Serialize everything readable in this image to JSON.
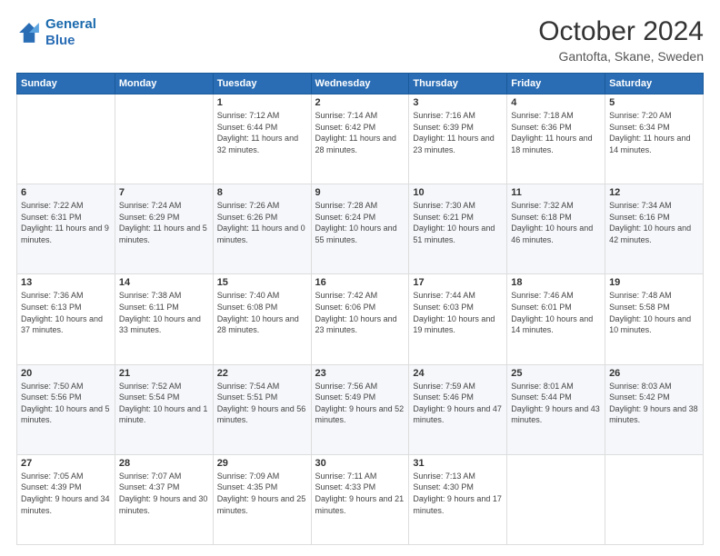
{
  "logo": {
    "line1": "General",
    "line2": "Blue"
  },
  "title": "October 2024",
  "subtitle": "Gantofta, Skane, Sweden",
  "headers": [
    "Sunday",
    "Monday",
    "Tuesday",
    "Wednesday",
    "Thursday",
    "Friday",
    "Saturday"
  ],
  "weeks": [
    [
      {
        "day": "",
        "detail": ""
      },
      {
        "day": "",
        "detail": ""
      },
      {
        "day": "1",
        "detail": "Sunrise: 7:12 AM\nSunset: 6:44 PM\nDaylight: 11 hours and 32 minutes."
      },
      {
        "day": "2",
        "detail": "Sunrise: 7:14 AM\nSunset: 6:42 PM\nDaylight: 11 hours and 28 minutes."
      },
      {
        "day": "3",
        "detail": "Sunrise: 7:16 AM\nSunset: 6:39 PM\nDaylight: 11 hours and 23 minutes."
      },
      {
        "day": "4",
        "detail": "Sunrise: 7:18 AM\nSunset: 6:36 PM\nDaylight: 11 hours and 18 minutes."
      },
      {
        "day": "5",
        "detail": "Sunrise: 7:20 AM\nSunset: 6:34 PM\nDaylight: 11 hours and 14 minutes."
      }
    ],
    [
      {
        "day": "6",
        "detail": "Sunrise: 7:22 AM\nSunset: 6:31 PM\nDaylight: 11 hours and 9 minutes."
      },
      {
        "day": "7",
        "detail": "Sunrise: 7:24 AM\nSunset: 6:29 PM\nDaylight: 11 hours and 5 minutes."
      },
      {
        "day": "8",
        "detail": "Sunrise: 7:26 AM\nSunset: 6:26 PM\nDaylight: 11 hours and 0 minutes."
      },
      {
        "day": "9",
        "detail": "Sunrise: 7:28 AM\nSunset: 6:24 PM\nDaylight: 10 hours and 55 minutes."
      },
      {
        "day": "10",
        "detail": "Sunrise: 7:30 AM\nSunset: 6:21 PM\nDaylight: 10 hours and 51 minutes."
      },
      {
        "day": "11",
        "detail": "Sunrise: 7:32 AM\nSunset: 6:18 PM\nDaylight: 10 hours and 46 minutes."
      },
      {
        "day": "12",
        "detail": "Sunrise: 7:34 AM\nSunset: 6:16 PM\nDaylight: 10 hours and 42 minutes."
      }
    ],
    [
      {
        "day": "13",
        "detail": "Sunrise: 7:36 AM\nSunset: 6:13 PM\nDaylight: 10 hours and 37 minutes."
      },
      {
        "day": "14",
        "detail": "Sunrise: 7:38 AM\nSunset: 6:11 PM\nDaylight: 10 hours and 33 minutes."
      },
      {
        "day": "15",
        "detail": "Sunrise: 7:40 AM\nSunset: 6:08 PM\nDaylight: 10 hours and 28 minutes."
      },
      {
        "day": "16",
        "detail": "Sunrise: 7:42 AM\nSunset: 6:06 PM\nDaylight: 10 hours and 23 minutes."
      },
      {
        "day": "17",
        "detail": "Sunrise: 7:44 AM\nSunset: 6:03 PM\nDaylight: 10 hours and 19 minutes."
      },
      {
        "day": "18",
        "detail": "Sunrise: 7:46 AM\nSunset: 6:01 PM\nDaylight: 10 hours and 14 minutes."
      },
      {
        "day": "19",
        "detail": "Sunrise: 7:48 AM\nSunset: 5:58 PM\nDaylight: 10 hours and 10 minutes."
      }
    ],
    [
      {
        "day": "20",
        "detail": "Sunrise: 7:50 AM\nSunset: 5:56 PM\nDaylight: 10 hours and 5 minutes."
      },
      {
        "day": "21",
        "detail": "Sunrise: 7:52 AM\nSunset: 5:54 PM\nDaylight: 10 hours and 1 minute."
      },
      {
        "day": "22",
        "detail": "Sunrise: 7:54 AM\nSunset: 5:51 PM\nDaylight: 9 hours and 56 minutes."
      },
      {
        "day": "23",
        "detail": "Sunrise: 7:56 AM\nSunset: 5:49 PM\nDaylight: 9 hours and 52 minutes."
      },
      {
        "day": "24",
        "detail": "Sunrise: 7:59 AM\nSunset: 5:46 PM\nDaylight: 9 hours and 47 minutes."
      },
      {
        "day": "25",
        "detail": "Sunrise: 8:01 AM\nSunset: 5:44 PM\nDaylight: 9 hours and 43 minutes."
      },
      {
        "day": "26",
        "detail": "Sunrise: 8:03 AM\nSunset: 5:42 PM\nDaylight: 9 hours and 38 minutes."
      }
    ],
    [
      {
        "day": "27",
        "detail": "Sunrise: 7:05 AM\nSunset: 4:39 PM\nDaylight: 9 hours and 34 minutes."
      },
      {
        "day": "28",
        "detail": "Sunrise: 7:07 AM\nSunset: 4:37 PM\nDaylight: 9 hours and 30 minutes."
      },
      {
        "day": "29",
        "detail": "Sunrise: 7:09 AM\nSunset: 4:35 PM\nDaylight: 9 hours and 25 minutes."
      },
      {
        "day": "30",
        "detail": "Sunrise: 7:11 AM\nSunset: 4:33 PM\nDaylight: 9 hours and 21 minutes."
      },
      {
        "day": "31",
        "detail": "Sunrise: 7:13 AM\nSunset: 4:30 PM\nDaylight: 9 hours and 17 minutes."
      },
      {
        "day": "",
        "detail": ""
      },
      {
        "day": "",
        "detail": ""
      }
    ]
  ]
}
